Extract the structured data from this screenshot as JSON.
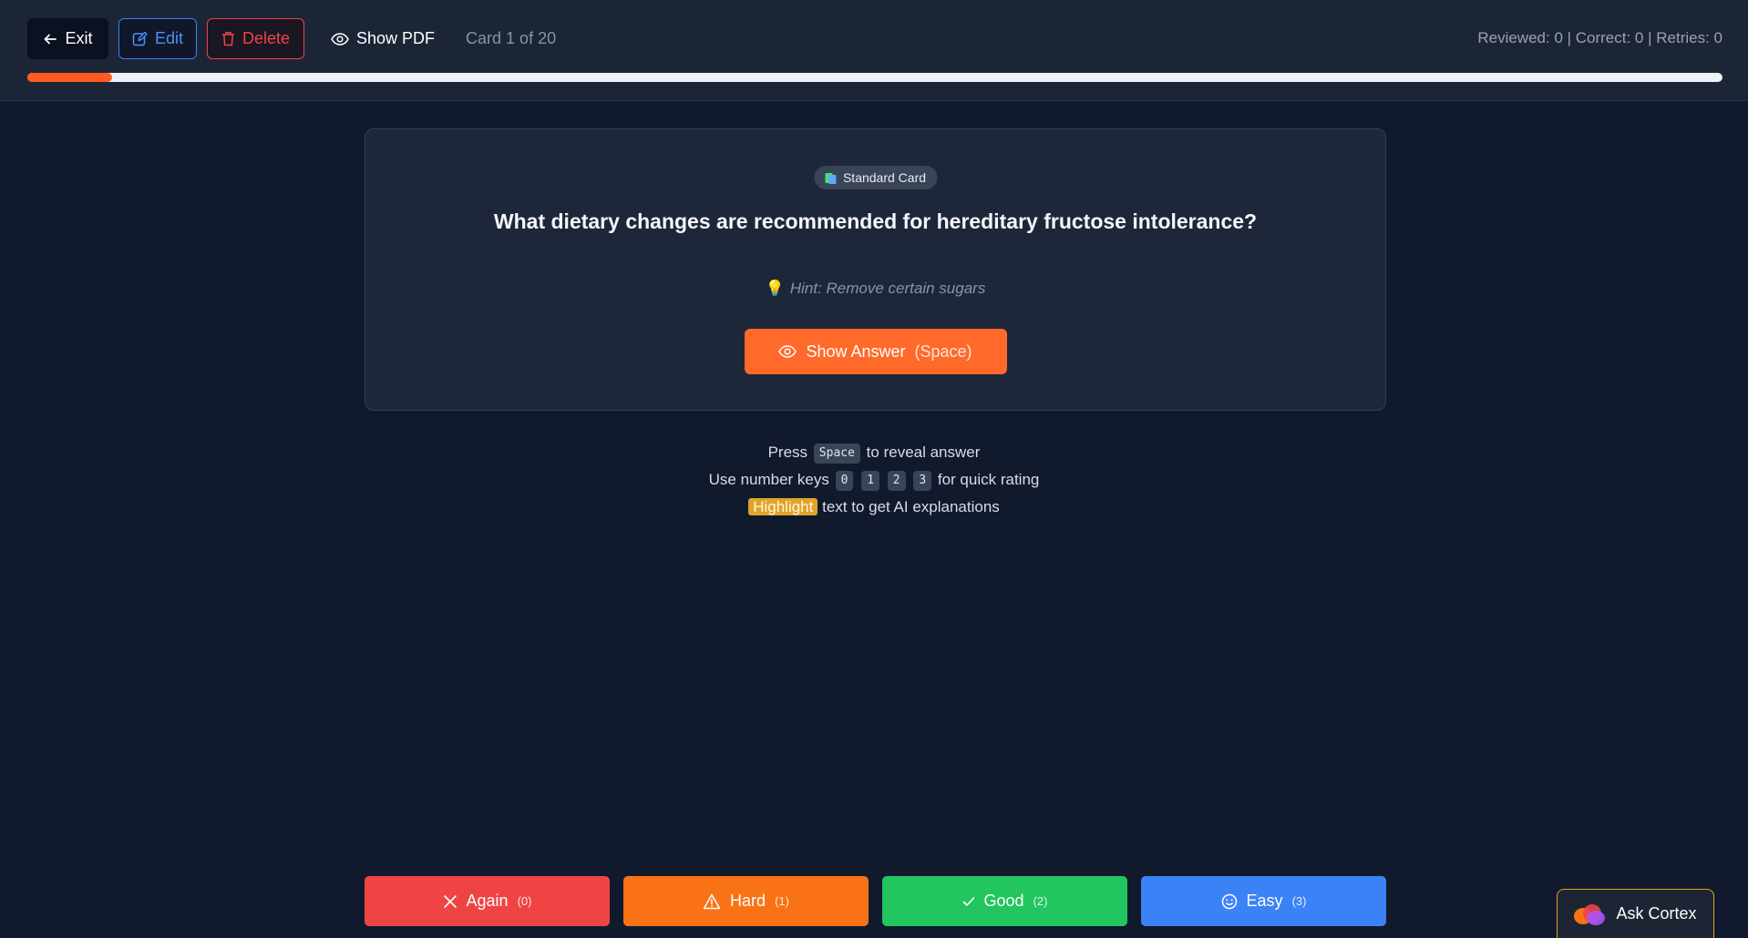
{
  "toolbar": {
    "exit_label": "Exit",
    "edit_label": "Edit",
    "delete_label": "Delete",
    "show_pdf_label": "Show PDF",
    "card_counter": "Card 1 of 20",
    "stats": "Reviewed: 0 | Correct: 0 | Retries: 0"
  },
  "progress": {
    "fraction": 0.05
  },
  "card": {
    "badge_label": "Standard Card",
    "question": "What dietary changes are recommended for hereditary fructose intolerance?",
    "hint": "Hint: Remove certain sugars",
    "show_answer_label": "Show Answer",
    "show_answer_key": "(Space)"
  },
  "instructions": {
    "line1_pre": "Press",
    "line1_key": "Space",
    "line1_post": "to reveal answer",
    "line2_pre": "Use number keys",
    "line2_keys": [
      "0",
      "1",
      "2",
      "3"
    ],
    "line2_post": "for quick rating",
    "line3_highlight": "Highlight",
    "line3_post": "text to get AI explanations"
  },
  "ratings": [
    {
      "label": "Again",
      "key": "(0)",
      "color": "#ef4444",
      "icon": "x-icon"
    },
    {
      "label": "Hard",
      "key": "(1)",
      "color": "#f97316",
      "icon": "warning-icon"
    },
    {
      "label": "Good",
      "key": "(2)",
      "color": "#22c55e",
      "icon": "check-icon"
    },
    {
      "label": "Easy",
      "key": "(3)",
      "color": "#3b82f6",
      "icon": "smile-icon"
    }
  ],
  "assistant": {
    "label": "Ask Cortex"
  },
  "colors": {
    "accent": "#ff6a2b",
    "background": "#111a2c",
    "card": "#1e2739"
  }
}
